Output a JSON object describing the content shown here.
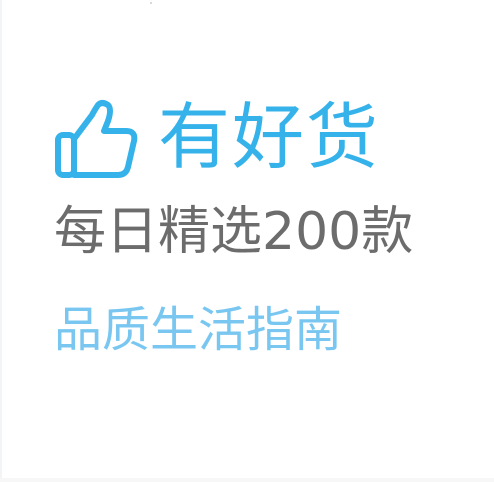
{
  "colors": {
    "brand_blue": "#36b2ea",
    "gray_text": "#6c6c6c",
    "light_blue": "#79c7f1"
  },
  "icons": {
    "thumb": "thumbs-up-icon"
  },
  "headline": {
    "title": "有好货"
  },
  "tagline": "每日精选200款",
  "slogan": "品质生活指南"
}
